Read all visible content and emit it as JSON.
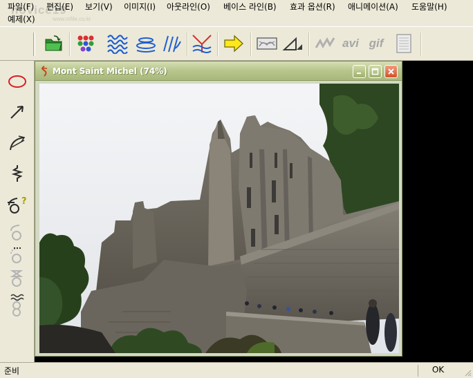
{
  "watermark": {
    "brand": "novice19",
    "url": "www.mfile.co.kr"
  },
  "menu": {
    "items": [
      "파일(F)",
      "편집(E)",
      "보기(V)",
      "이미지(I)",
      "아웃라인(O)",
      "베이스 라인(B)",
      "효과 옵션(R)",
      "애니메이션(A)",
      "도움말(H)",
      "예제(X)"
    ]
  },
  "toolbar": {
    "text_buttons": {
      "avi": "avi",
      "gif": "gif"
    },
    "icons": [
      "open-folder-icon",
      "color-dots-icon",
      "waves-icon",
      "ellipse-lines-icon",
      "slanted-lines-icon",
      "funnel-lines-icon",
      "arrow-right-icon",
      "image-frame-icon",
      "triangle-icon",
      "wave-disabled-icon",
      "avi-icon",
      "gif-icon",
      "document-icon"
    ]
  },
  "tools": {
    "icons": [
      "ellipse-tool-icon",
      "line-arrow-tool-icon",
      "arc-tool-icon",
      "zigzag-tool-icon",
      "shape-help-icon",
      "shape-circle-icon",
      "shape-dots-icon",
      "shape-hourglass-icon",
      "shape-wave-circles-icon"
    ]
  },
  "image_window": {
    "title": "Mont Saint Michel  (74%)",
    "colors": {
      "title_bar": "#b9c78f",
      "close_button": "#d4502b"
    }
  },
  "status": {
    "left": "준비",
    "right": "OK"
  }
}
